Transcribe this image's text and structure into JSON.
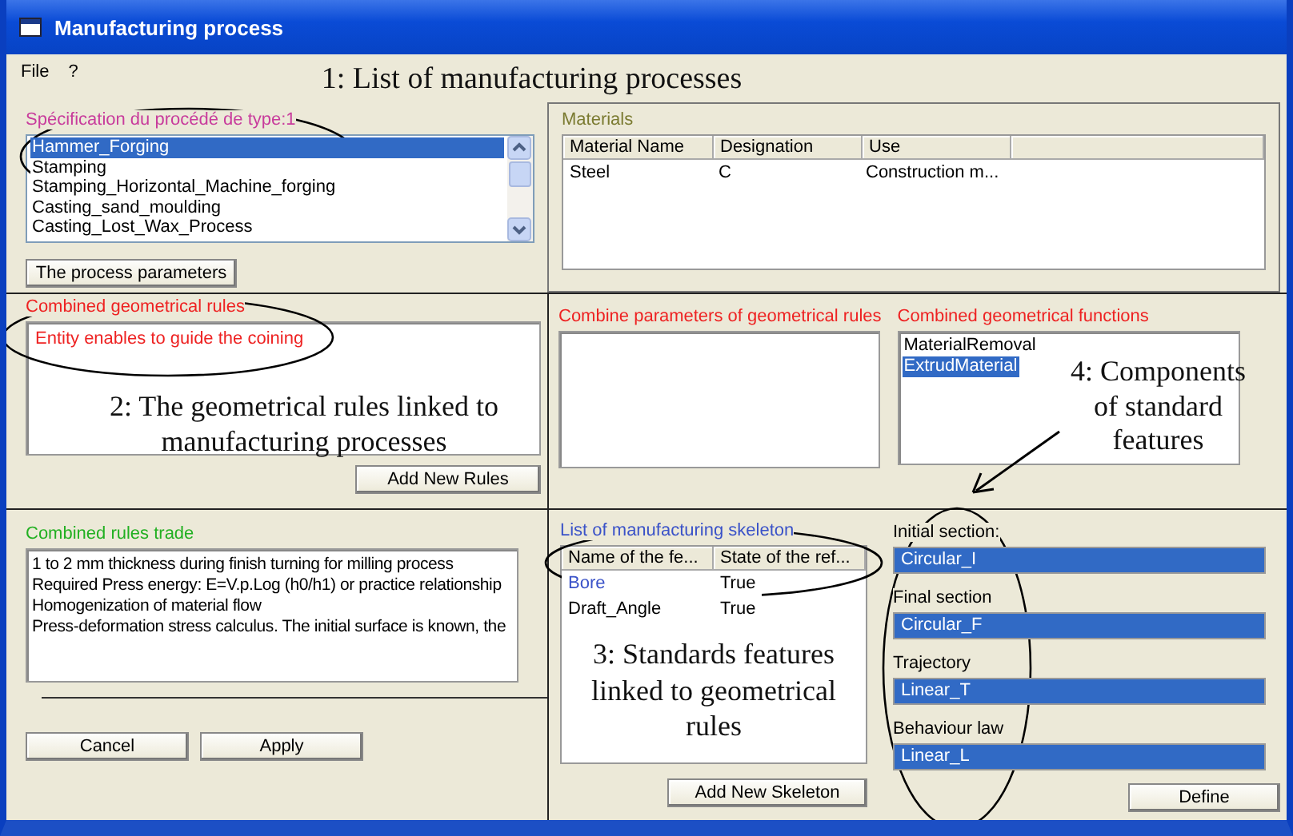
{
  "window": {
    "title": "Manufacturing process"
  },
  "menu": [
    {
      "label": "File"
    },
    {
      "label": "?"
    }
  ],
  "header_note": "1: List of manufacturing processes",
  "process_spec": {
    "label": "Spécification du procédé de type:1",
    "items": [
      {
        "text": "Hammer_Forging",
        "selected": true
      },
      {
        "text": "Stamping",
        "selected": false
      },
      {
        "text": "Stamping_Horizontal_Machine_forging",
        "selected": false
      },
      {
        "text": "Casting_sand_moulding",
        "selected": false
      },
      {
        "text": "Casting_Lost_Wax_Process",
        "selected": false
      }
    ],
    "button": "The process parameters"
  },
  "materials": {
    "label": "Materials",
    "columns": [
      "Material Name",
      "Designation",
      "Use"
    ],
    "rows": [
      {
        "cells": [
          "Steel",
          "C",
          "Construction m..."
        ]
      }
    ]
  },
  "geometrical_rules": {
    "label": "Combined geometrical rules",
    "items": [
      "Entity enables to guide the coining"
    ],
    "note": "2: The geometrical rules linked to manufacturing processes",
    "button": "Add New Rules"
  },
  "combine_parameters": {
    "label": "Combine parameters of geometrical rules"
  },
  "geometrical_functions": {
    "label": "Combined geometrical functions",
    "items": [
      {
        "text": "MaterialRemoval",
        "selected": false
      },
      {
        "text": "ExtrudMaterial",
        "selected": true
      }
    ],
    "note": "4: Components of standard features"
  },
  "rules_trade": {
    "label": "Combined rules trade",
    "lines": [
      "1 to 2 mm thickness during finish turning for milling process",
      "Required Press energy:  E=V.p.Log (h0/h1) or practice relationship",
      "Homogenization of material flow",
      "Press-deformation stress calculus. The initial surface is known, the"
    ]
  },
  "actions": [
    "Cancel",
    "Apply"
  ],
  "skeleton": {
    "label": "List of manufacturing skeleton",
    "columns": [
      "Name of the fe...",
      "State of the ref..."
    ],
    "rows": [
      {
        "name": "Bore",
        "state": "True",
        "selected": true
      },
      {
        "name": "Draft_Angle",
        "state": "True",
        "selected": false
      }
    ],
    "note": "3: Standards features linked to geometrical rules",
    "button": "Add New Skeleton"
  },
  "sections": [
    {
      "label": "Initial section:",
      "value": "Circular_I",
      "selected": true
    },
    {
      "label": "Final section",
      "value": "Circular_F",
      "selected": true
    },
    {
      "label": "Trajectory",
      "value": "Linear_T",
      "selected": true
    },
    {
      "label": "Behaviour law",
      "value": "Linear_L",
      "selected": true
    }
  ],
  "define_button": "Define"
}
